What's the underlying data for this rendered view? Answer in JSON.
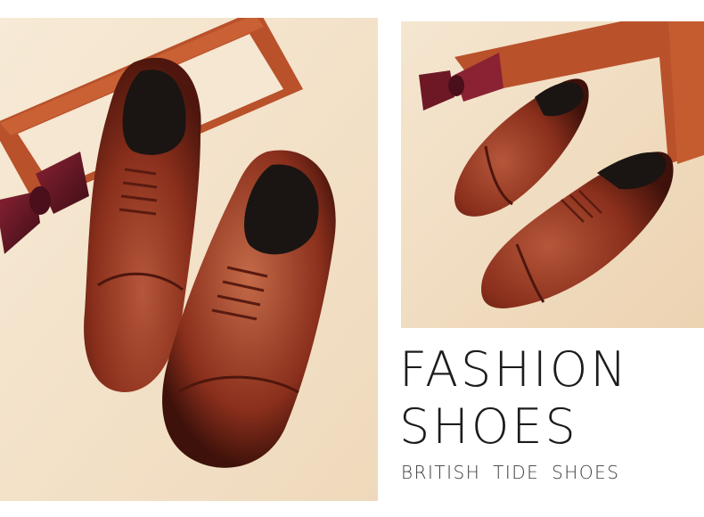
{
  "headline": {
    "line1": "FASHION",
    "line2": "SHOES",
    "subtitle": "BRITISH TIDE SHOES"
  },
  "colors": {
    "background_cream": "#f4e6d0",
    "frame_wood": "#b84a26",
    "shoe_leather": "#7a2516",
    "shoe_leather_light": "#a64a2c",
    "bow_tie": "#5e1420",
    "text": "#1c1c1c"
  },
  "images": [
    "photo-brown-cap-toe-oxford-shoes-top-view",
    "photo-brown-cap-toe-oxford-shoes-angled-view"
  ]
}
